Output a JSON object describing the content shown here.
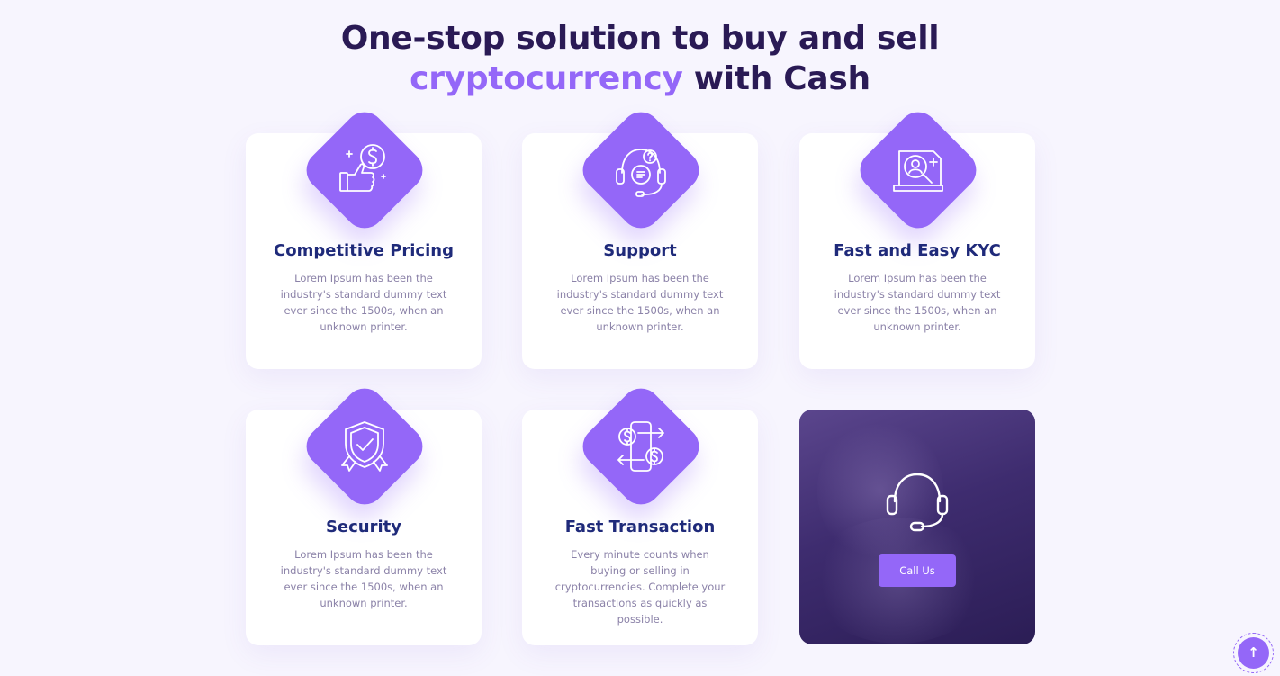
{
  "heading": {
    "line1": "One-stop solution to buy and sell",
    "accent": "cryptocurrency",
    "rest": " with Cash"
  },
  "colors": {
    "accent": "#9467f8",
    "title": "#2a1a55",
    "card_title": "#1f2a7a",
    "body_text": "#8b82a8",
    "background": "#f7f5fe"
  },
  "features": [
    {
      "icon": "thumbs-up-dollar-icon",
      "title": "Competitive Pricing",
      "text": "Lorem Ipsum has been the industry's standard dummy text ever since the 1500s, when an unknown printer."
    },
    {
      "icon": "support-headset-icon",
      "title": "Support",
      "text": "Lorem Ipsum has been the industry's standard dummy text ever since the 1500s, when an unknown printer."
    },
    {
      "icon": "kyc-search-user-icon",
      "title": "Fast and Easy KYC",
      "text": "Lorem Ipsum has been the industry's standard dummy text ever since the 1500s, when an unknown printer."
    },
    {
      "icon": "shield-check-icon",
      "title": "Security",
      "text": "Lorem Ipsum has been the industry's standard dummy text ever since the 1500s, when an unknown printer."
    },
    {
      "icon": "dollar-exchange-icon",
      "title": "Fast Transaction",
      "text": "Every minute counts when buying or selling in cryptocurrencies. Complete your transactions as quickly as possible."
    }
  ],
  "cta_card": {
    "icon": "headset-icon",
    "button_label": "Call Us"
  },
  "scroll_top": {
    "icon": "arrow-up-icon",
    "glyph": "↑"
  }
}
